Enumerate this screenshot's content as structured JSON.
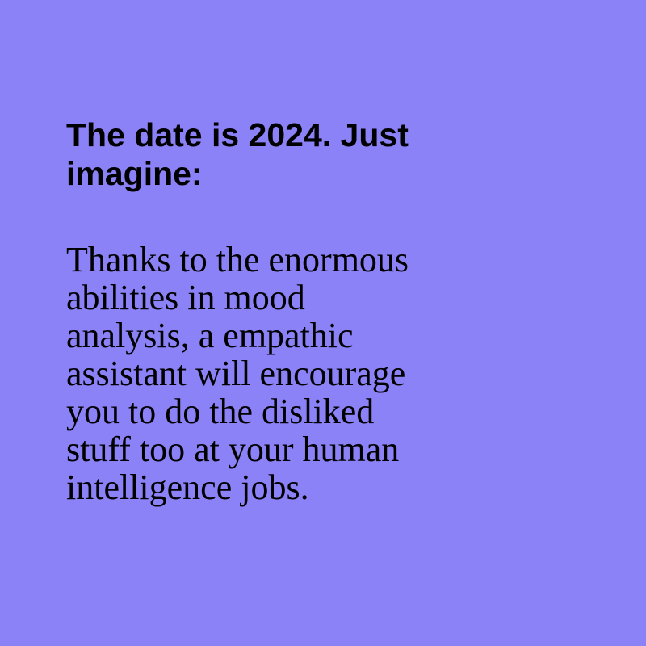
{
  "colors": {
    "background": "#8c82f7",
    "text": "#000000"
  },
  "headline": {
    "lines": [
      "The date is 2024. Just",
      "imagine:"
    ]
  },
  "body": {
    "lines": [
      "Thanks to the enormous",
      "abilities in mood",
      "analysis, a empathic",
      "assistant will encourage",
      "you to do the disliked",
      "stuff too at your human",
      "intelligence jobs."
    ]
  }
}
